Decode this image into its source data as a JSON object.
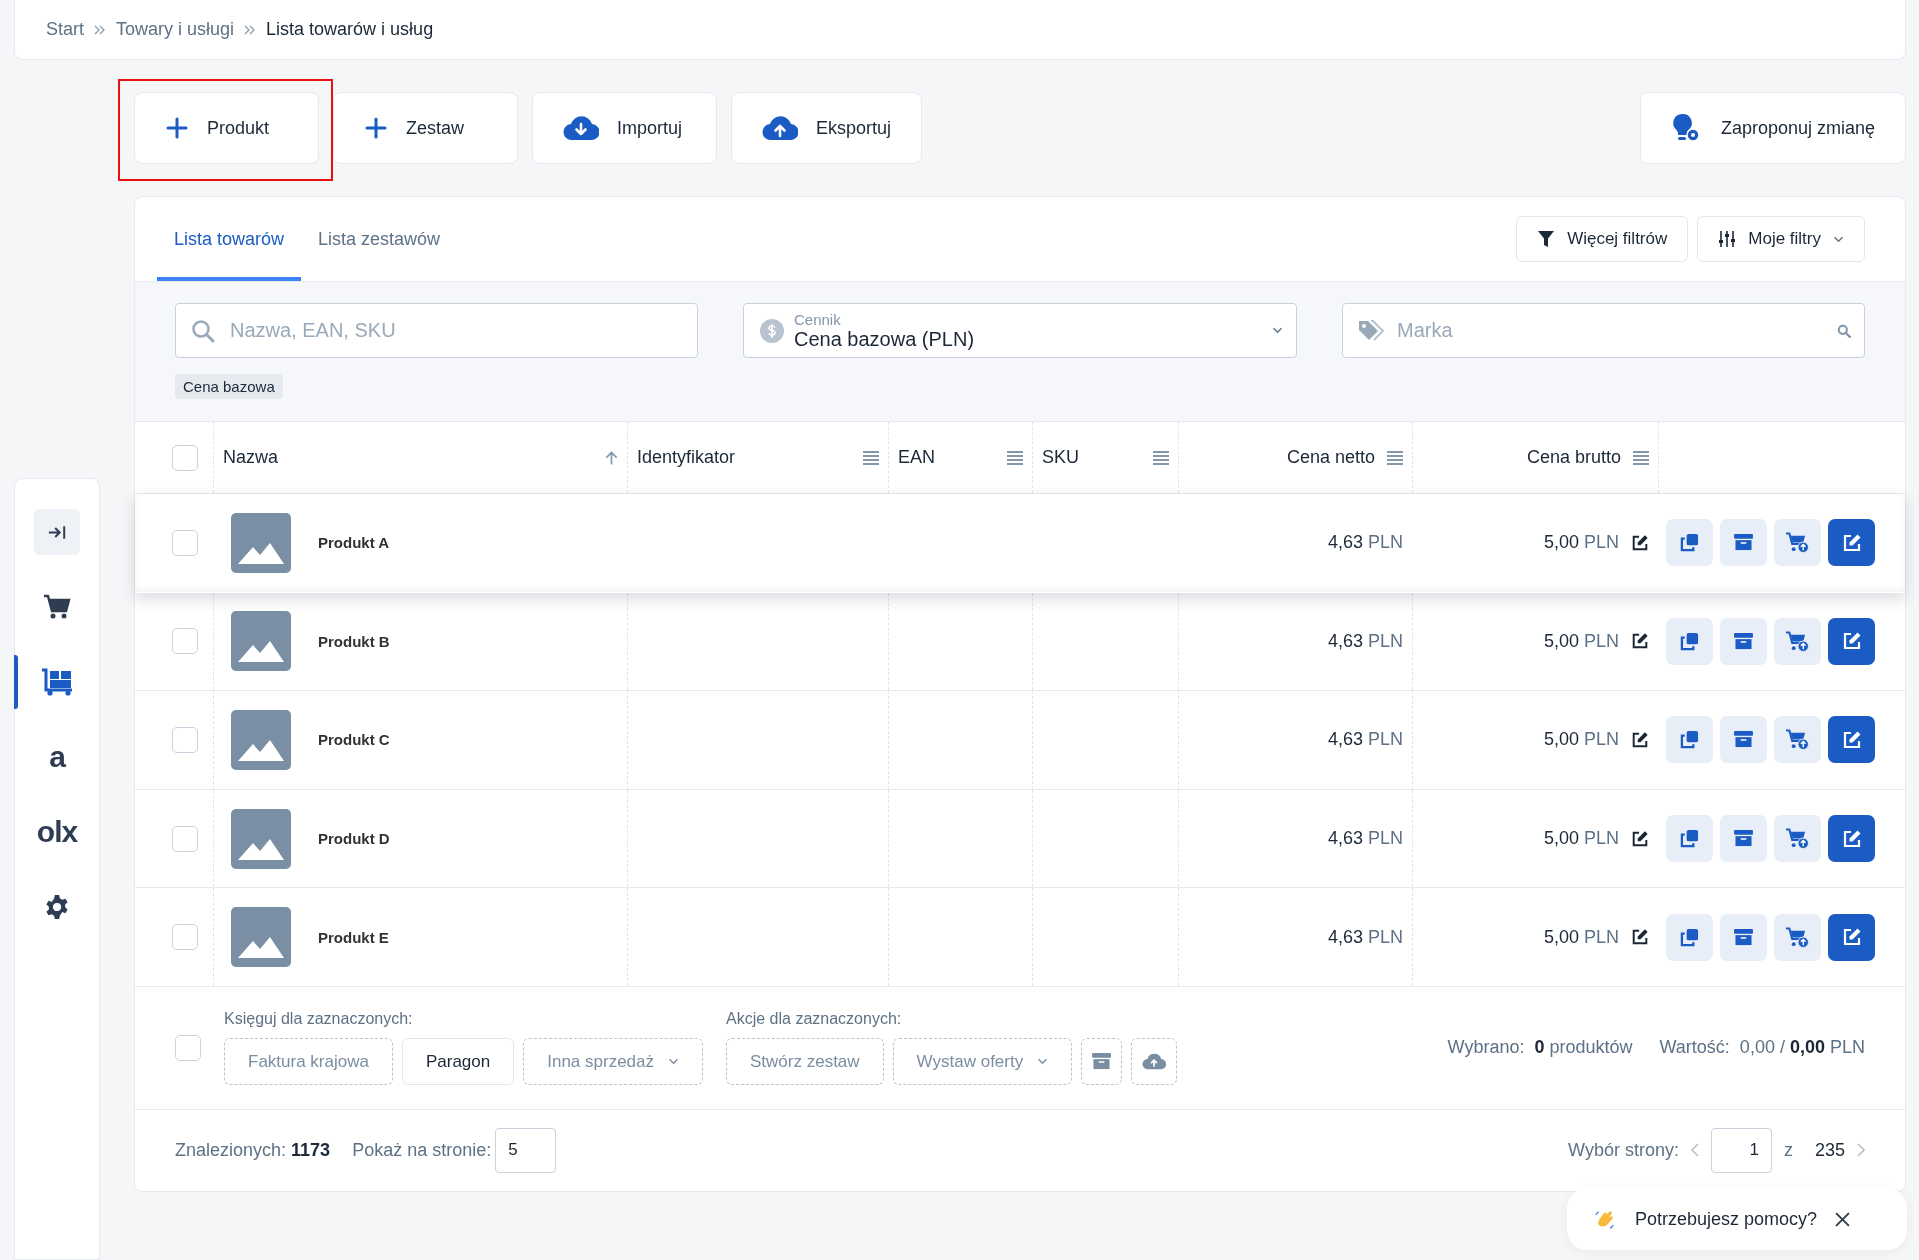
{
  "breadcrumb": [
    {
      "label": "Start",
      "current": false
    },
    {
      "label": "Towary i usługi",
      "current": false
    },
    {
      "label": "Lista towarów i usług",
      "current": true
    }
  ],
  "toolbar_buttons": [
    {
      "label": "Produkt",
      "kind": "plus",
      "highlighted": true
    },
    {
      "label": "Zestaw",
      "kind": "plus",
      "highlighted": false
    },
    {
      "label": "Importuj",
      "kind": "download",
      "highlighted": false
    },
    {
      "label": "Eksportuj",
      "kind": "upload",
      "highlighted": false
    }
  ],
  "suggest_button": {
    "label": "Zaproponuj zmianę"
  },
  "sidebar": {
    "items": [
      {
        "kind": "collapse",
        "selected": false
      },
      {
        "kind": "cart",
        "selected": false
      },
      {
        "kind": "products",
        "selected": true
      },
      {
        "kind": "text",
        "label": "a",
        "selected": false
      },
      {
        "kind": "text",
        "label": "olx",
        "selected": false
      },
      {
        "kind": "settings",
        "selected": false
      }
    ]
  },
  "tabs": [
    {
      "label": "Lista towarów",
      "selected": true
    },
    {
      "label": "Lista zestawów",
      "selected": false
    }
  ],
  "filter_buttons": [
    {
      "label": "Więcej filtrów",
      "kind": "filter"
    },
    {
      "label": "Moje filtry",
      "kind": "presets"
    }
  ],
  "search": {
    "placeholder": "Nazwa, EAN, SKU"
  },
  "price_list": {
    "label": "Cennik",
    "value": "Cena bazowa (PLN)"
  },
  "brand": {
    "placeholder": "Marka"
  },
  "active_tags": [
    "Cena bazowa"
  ],
  "table": {
    "columns": [
      {
        "label": "Nazwa",
        "kind": "sort"
      },
      {
        "label": "Identyfikator",
        "kind": "menu"
      },
      {
        "label": "EAN",
        "kind": "menu"
      },
      {
        "label": "SKU",
        "kind": "menu"
      },
      {
        "label": "Cena netto",
        "kind": "menu"
      },
      {
        "label": "Cena brutto",
        "kind": "menu"
      }
    ],
    "header_checked": false,
    "rows": [
      {
        "name": "Produkt A",
        "net": "4,63",
        "net_currency": "PLN",
        "gross": "5,00",
        "gross_currency": "PLN",
        "checked": false,
        "hovered": true
      },
      {
        "name": "Produkt B",
        "net": "4,63",
        "net_currency": "PLN",
        "gross": "5,00",
        "gross_currency": "PLN",
        "checked": false,
        "hovered": false
      },
      {
        "name": "Produkt C",
        "net": "4,63",
        "net_currency": "PLN",
        "gross": "5,00",
        "gross_currency": "PLN",
        "checked": false,
        "hovered": false
      },
      {
        "name": "Produkt D",
        "net": "4,63",
        "net_currency": "PLN",
        "gross": "5,00",
        "gross_currency": "PLN",
        "checked": false,
        "hovered": false
      },
      {
        "name": "Produkt E",
        "net": "4,63",
        "net_currency": "PLN",
        "gross": "5,00",
        "gross_currency": "PLN",
        "checked": false,
        "hovered": false
      }
    ]
  },
  "bulk": {
    "checked": false,
    "booking": {
      "label": "Księguj dla zaznaczonych:",
      "buttons": [
        {
          "label": "Faktura krajowa",
          "disabled": true,
          "dropdown": false
        },
        {
          "label": "Paragon",
          "disabled": false,
          "dropdown": false
        },
        {
          "label": "Inna sprzedaż",
          "disabled": true,
          "dropdown": true
        }
      ]
    },
    "actions": {
      "label": "Akcje dla zaznaczonych:",
      "buttons": [
        {
          "label": "Stwórz zestaw",
          "disabled": true,
          "dropdown": false
        },
        {
          "label": "Wystaw oferty",
          "disabled": true,
          "dropdown": true
        }
      ],
      "icon_buttons": [
        {
          "kind": "archive",
          "disabled": true
        },
        {
          "kind": "upload",
          "disabled": true
        }
      ]
    },
    "selected_label": "Wybrano:",
    "selected_count": "0",
    "selected_unit": "produktów",
    "value_label": "Wartość:",
    "value_net": "0,00 /",
    "value_gross": "0,00",
    "value_currency": "PLN"
  },
  "footer": {
    "found_label": "Znalezionych:",
    "found": "1173",
    "per_page_label": "Pokaż na stronie:",
    "per_page": "5",
    "page_label": "Wybór strony:",
    "page": "1",
    "of": "z",
    "pages": "235"
  },
  "help": {
    "label": "Potrzebujesz pomocy?"
  }
}
